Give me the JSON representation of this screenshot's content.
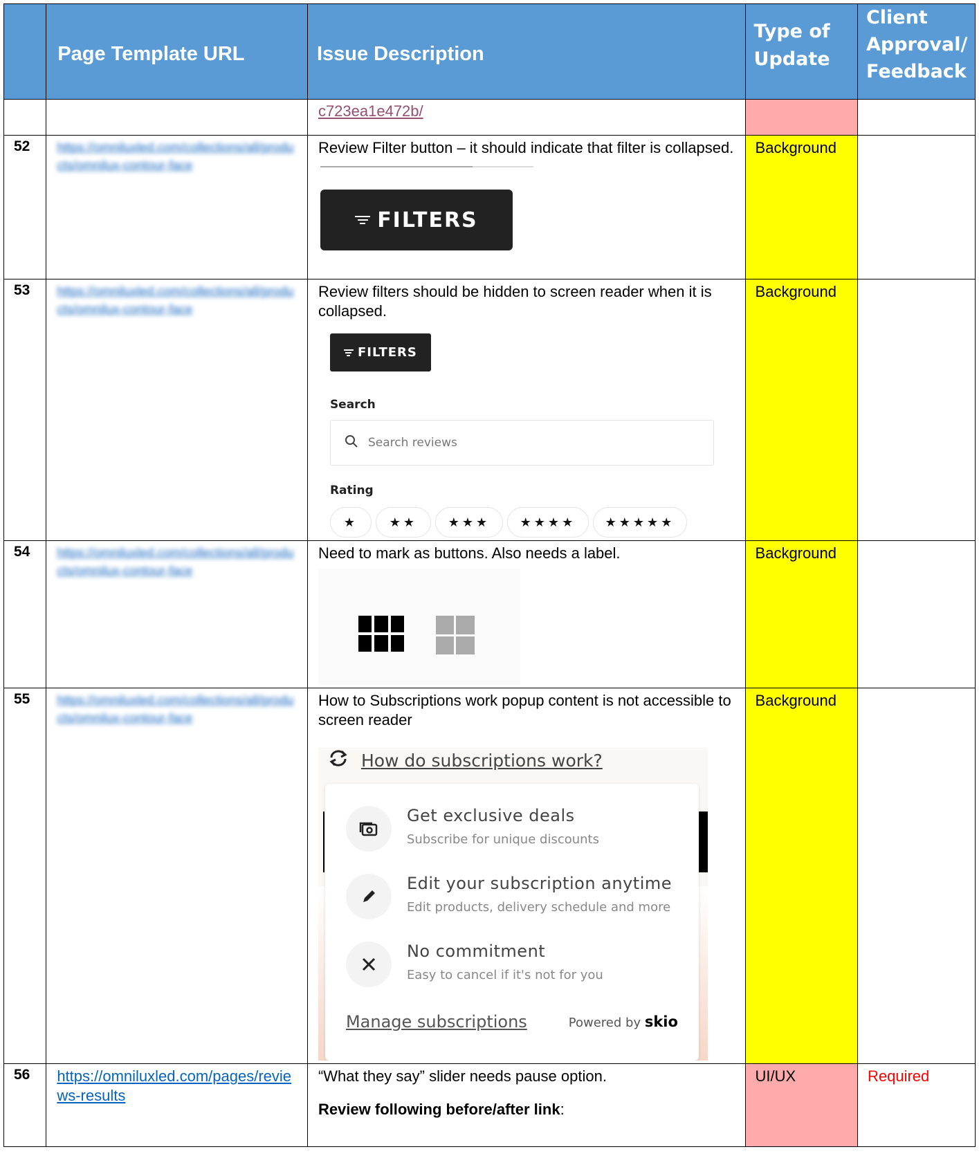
{
  "header": {
    "col_num": "",
    "col_url": "Page Template URL",
    "col_issue": "Issue Description",
    "col_type": "Type of Update",
    "col_client": "Client Approval/ Feedback"
  },
  "rows": {
    "prev": {
      "link_tail": "c723ea1e472b/"
    },
    "r52": {
      "num": "52",
      "url": "https://omniluxled.com/collections/all/products/omnilux-contour-face",
      "issue": "Review Filter button – it should indicate that filter is collapsed.",
      "type": "Background",
      "filters_label": "FILTERS"
    },
    "r53": {
      "num": "53",
      "url": "https://omniluxled.com/collections/all/products/omnilux-contour-face",
      "issue": "Review filters should be hidden to screen reader when it is collapsed.",
      "type": "Background",
      "filters_label": "FILTERS",
      "search_label": "Search",
      "search_placeholder": "Search reviews",
      "rating_label": "Rating",
      "ratings": [
        "★",
        "★★",
        "★★★",
        "★★★★",
        "★★★★★"
      ]
    },
    "r54": {
      "num": "54",
      "url": "https://omniluxled.com/collections/all/products/omnilux-contour-face",
      "issue": "Need to mark as buttons. Also needs a label.",
      "type": "Background"
    },
    "r55": {
      "num": "55",
      "url": "https://omniluxled.com/collections/all/products/omnilux-contour-face",
      "issue": "How to Subscriptions work popup content is not accessible to screen reader",
      "type": "Background",
      "popup": {
        "heading": "How do subscriptions work?",
        "items": [
          {
            "title": "Get exclusive deals",
            "sub": "Subscribe for unique discounts",
            "icon": "camera-icon"
          },
          {
            "title": "Edit your subscription anytime",
            "sub": "Edit products, delivery schedule and more",
            "icon": "pencil-icon"
          },
          {
            "title": "No commitment",
            "sub": "Easy to cancel if it's not for you",
            "icon": "close-icon"
          }
        ],
        "manage": "Manage subscriptions",
        "powered": "Powered by",
        "brand": "skio"
      }
    },
    "r56": {
      "num": "56",
      "url": "https://omniluxled.com/pages/reviews-results",
      "issue": "“What they say” slider needs pause option.",
      "review_bold": "Review following before/after link",
      "review_colon": ":",
      "type": "UI/UX",
      "client": "Required"
    }
  },
  "colors": {
    "header_blue": "#5b9bd5",
    "background_yellow": "#ffff00",
    "uiux_pink": "#ffabab",
    "required_red": "#ff0000"
  }
}
